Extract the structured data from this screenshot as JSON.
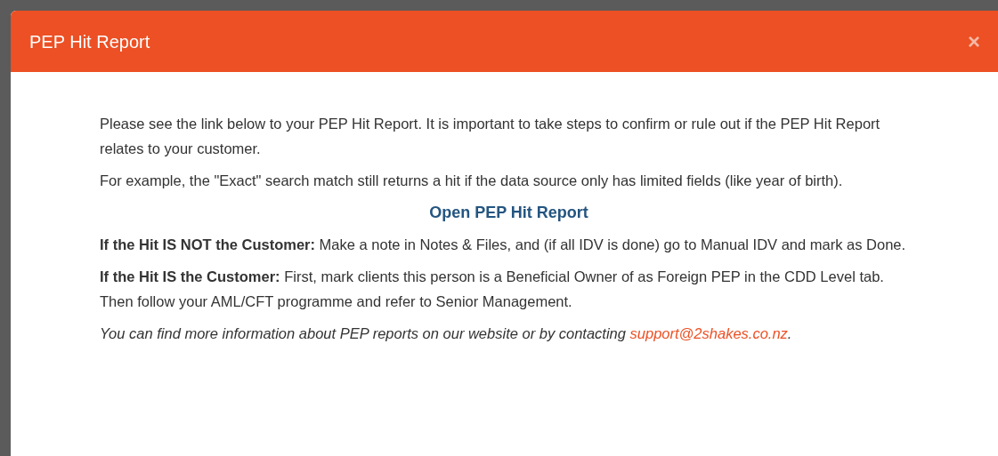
{
  "dialog": {
    "title": "PEP Hit Report",
    "close": "×"
  },
  "body": [
    {
      "kind": "paragraph",
      "text": "Please see the link below to your PEP Hit Report. It is important to take steps to confirm or rule out if the PEP Hit Report relates to your customer."
    },
    {
      "kind": "paragraph",
      "text": "For example, the \"Exact\" search match still returns a hit if the data source only has limited fields (like year of birth)."
    },
    {
      "kind": "link",
      "text": "Open PEP Hit Report"
    },
    {
      "kind": "paragraph",
      "text": "**If the Hit IS NOT the Customer:** Make a note in Notes & Files, and (if all IDV is done) go to Manual IDV and mark as Done."
    },
    {
      "kind": "paragraph",
      "text": "**If the Hit IS the Customer:** First, mark clients this person is a Beneficial Owner of as Foreign PEP in the CDD Level tab. Then follow your AML/CFT programme and refer to Senior Management."
    },
    {
      "kind": "note",
      "text": "You can find more information about PEP reports on our website or by contacting ",
      "link": "support@2shakes.co.nz",
      "after": "."
    }
  ]
}
